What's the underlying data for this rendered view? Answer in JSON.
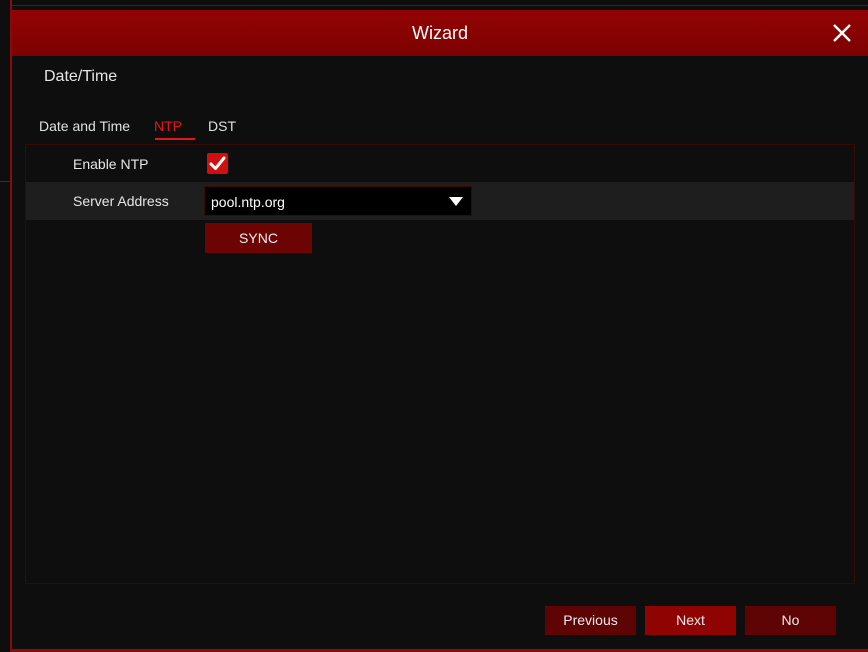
{
  "window": {
    "title": "Wizard",
    "close_icon": "close-icon"
  },
  "section": {
    "title": "Date/Time"
  },
  "tabs": [
    {
      "label": "Date and Time",
      "active": false
    },
    {
      "label": "NTP",
      "active": true
    },
    {
      "label": "DST",
      "active": false
    }
  ],
  "ntp": {
    "enable_label": "Enable NTP",
    "enabled": true,
    "server_label": "Server Address",
    "server_value": "pool.ntp.org",
    "sync_label": "SYNC"
  },
  "footer": {
    "previous_label": "Previous",
    "next_label": "Next",
    "no_label": "No"
  },
  "colors": {
    "accent": "#e51616",
    "titlebar": "#8a0303",
    "button_dark": "#5f0404",
    "button_primary": "#8f0303"
  }
}
